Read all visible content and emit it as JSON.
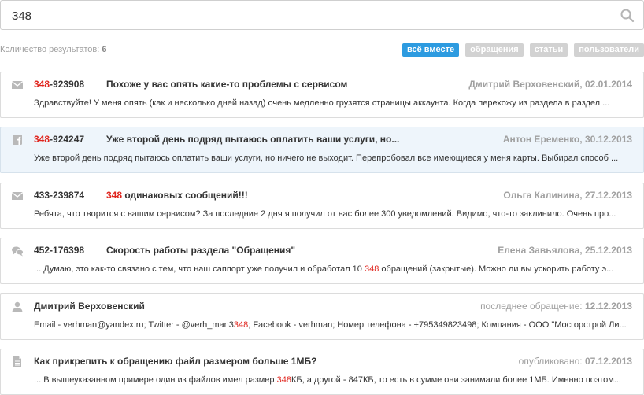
{
  "search": {
    "value": "348"
  },
  "results": {
    "label": "Количество результатов:",
    "count": "6"
  },
  "filters": [
    {
      "label": "всё вместе"
    },
    {
      "label": "обращения"
    },
    {
      "label": "статьи"
    },
    {
      "label": "пользователи"
    }
  ],
  "items": [
    {
      "icon": "envelope-icon",
      "number_pre": "",
      "number_hl": "348",
      "number_post": "-923908",
      "title_pre": "Похоже у вас опять какие-то проблемы с сервисом",
      "title_hl": "",
      "title_post": "",
      "right_label": "Дмитрий Верховенский, ",
      "right_date": "02.01.2014",
      "snippet_pre": "Здравствуйте! У меня опять (как и несколько дней назад) очень медленно грузятся страницы аккаунта. Когда перехожу из раздела в раздел ...",
      "snippet_hl": "",
      "snippet_post": ""
    },
    {
      "icon": "facebook-icon",
      "number_pre": "",
      "number_hl": "348",
      "number_post": "-924247",
      "title_pre": "Уже второй день подряд пытаюсь оплатить ваши услуги, но...",
      "title_hl": "",
      "title_post": "",
      "right_label": "Антон Еременко, ",
      "right_date": "30.12.2013",
      "snippet_pre": "Уже второй день подряд пытаюсь оплатить ваши услуги, но ничего не выходит. Перепробовал все имеющиеся у меня карты. Выбирал способ ...",
      "snippet_hl": "",
      "snippet_post": ""
    },
    {
      "icon": "envelope-icon",
      "number_pre": "433-239874",
      "number_hl": "",
      "number_post": "",
      "title_pre": "",
      "title_hl": "348",
      "title_post": " одинаковых сообщений!!!",
      "right_label": "Ольга Калинина, ",
      "right_date": "27.12.2013",
      "snippet_pre": "Ребята, что творится с вашим сервисом? За последние 2 дня я получил от вас более 300 уведомлений. Видимо, что-то заклинило. Очень про...",
      "snippet_hl": "",
      "snippet_post": ""
    },
    {
      "icon": "chat-icon",
      "number_pre": "452-176398",
      "number_hl": "",
      "number_post": "",
      "title_pre": "Скорость работы раздела \"Обращения\"",
      "title_hl": "",
      "title_post": "",
      "right_label": "Елена Завьялова, ",
      "right_date": "25.12.2013",
      "snippet_pre": "... Думаю, это как-то связано с тем, что наш саппорт уже получил и обработал 10 ",
      "snippet_hl": "348",
      "snippet_post": " обращений (закрытые). Можно ли вы ускорить работу э..."
    },
    {
      "icon": "user-icon",
      "number_pre": "",
      "number_hl": "",
      "number_post": "",
      "title_pre": "Дмитрий Верховенский",
      "title_hl": "",
      "title_post": "",
      "right_label": "последнее обращение: ",
      "right_date": "12.12.2013",
      "snippet_pre": "Email - verhman@yandex.ru; Twitter - @verh_man3",
      "snippet_hl": "348",
      "snippet_post": "; Facebook - verhman; Номер телефона - +795349823498; Компания - ООО \"Мосгорстрой Ли..."
    },
    {
      "icon": "document-icon",
      "number_pre": "",
      "number_hl": "",
      "number_post": "",
      "title_pre": "Как прикрепить к обращению файл размером больше 1МБ?",
      "title_hl": "",
      "title_post": "",
      "right_label": "опубликовано: ",
      "right_date": "07.12.2013",
      "snippet_pre": "... В вышеуказанном примере один из файлов имел размер ",
      "snippet_hl": "348",
      "snippet_post": "КБ, а другой - 847КБ, то есть в сумме они занимали более 1МБ. Именно поэтом..."
    }
  ]
}
